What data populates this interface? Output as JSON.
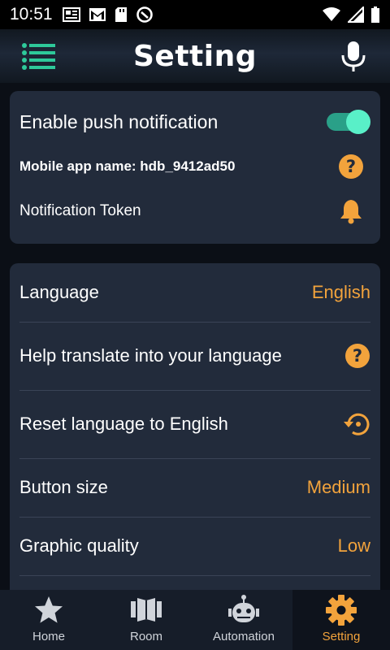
{
  "status_bar": {
    "time": "10:51"
  },
  "header": {
    "title": "Setting",
    "menu_icon": "menu-icon",
    "mic_icon": "mic-icon"
  },
  "notifications": {
    "push_label": "Enable push notification",
    "push_enabled": true,
    "app_name_label": "Mobile app name: hdb_9412ad50",
    "token_label": "Notification Token"
  },
  "settings": {
    "language_label": "Language",
    "language_value": "English",
    "help_translate_label": "Help translate into your language",
    "reset_language_label": "Reset language to English",
    "button_size_label": "Button size",
    "button_size_value": "Medium",
    "graphic_quality_label": "Graphic quality",
    "graphic_quality_value": "Low"
  },
  "nav": {
    "items": [
      {
        "label": "Home",
        "icon": "star-icon"
      },
      {
        "label": "Room",
        "icon": "room-icon"
      },
      {
        "label": "Automation",
        "icon": "robot-icon"
      },
      {
        "label": "Setting",
        "icon": "gear-icon",
        "active": true
      }
    ]
  },
  "colors": {
    "accent": "#f2a33c",
    "toggle_on": "#59f0c8",
    "card": "#222b3b"
  }
}
